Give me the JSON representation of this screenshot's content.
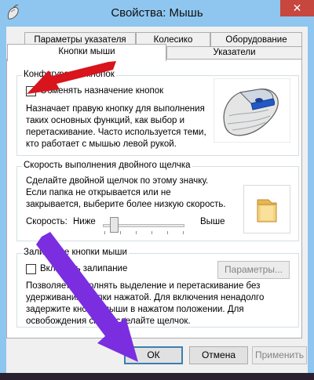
{
  "window": {
    "title": "Свойства: Мышь",
    "close_symbol": "✕",
    "icon": "mouse-icon"
  },
  "tabs": {
    "row_back": [
      "Параметры указателя",
      "Колесико",
      "Оборудование"
    ],
    "row_front": [
      "Кнопки мыши",
      "Указатели"
    ],
    "active": "Кнопки мыши"
  },
  "button_config": {
    "title": "Конфигурация кнопок",
    "checkbox_label": "Обменять назначение кнопок",
    "checked": false,
    "description": [
      "Назначает правую кнопку для выполнения",
      "таких основных функций, как выбор и",
      "перетаскивание. Часто используется теми,",
      "кто работает с мышью левой рукой."
    ]
  },
  "double_click": {
    "title": "Скорость выполнения двойного щелчка",
    "description": [
      "Сделайте двойной щелчок по этому значку.",
      "Если папка не открывается или не",
      "закрывается, выберите более низкую скорость."
    ],
    "speed_label": "Скорость:",
    "low_label": "Ниже",
    "high_label": "Выше",
    "slider_level": 0.1
  },
  "click_lock": {
    "title": "Залипание кнопки мыши",
    "checkbox_label": "Включить залипание",
    "checked": false,
    "params_button": "Параметры...",
    "description": [
      "Позволяет выполнять выделение и перетаскивание без",
      "удерживания кнопки нажатой. Для включения ненадолго",
      "задержите кнопку мыши в нажатом положении. Для",
      "освобождения снова сделайте щелчок."
    ]
  },
  "footer": {
    "ok": "ОК",
    "cancel": "Отмена",
    "apply": "Применить"
  },
  "colors": {
    "titlebar": "#8ec6ef",
    "close": "#c7463d",
    "red_arrow": "#d8141c",
    "purple_arrow": "#7b2ee0"
  }
}
